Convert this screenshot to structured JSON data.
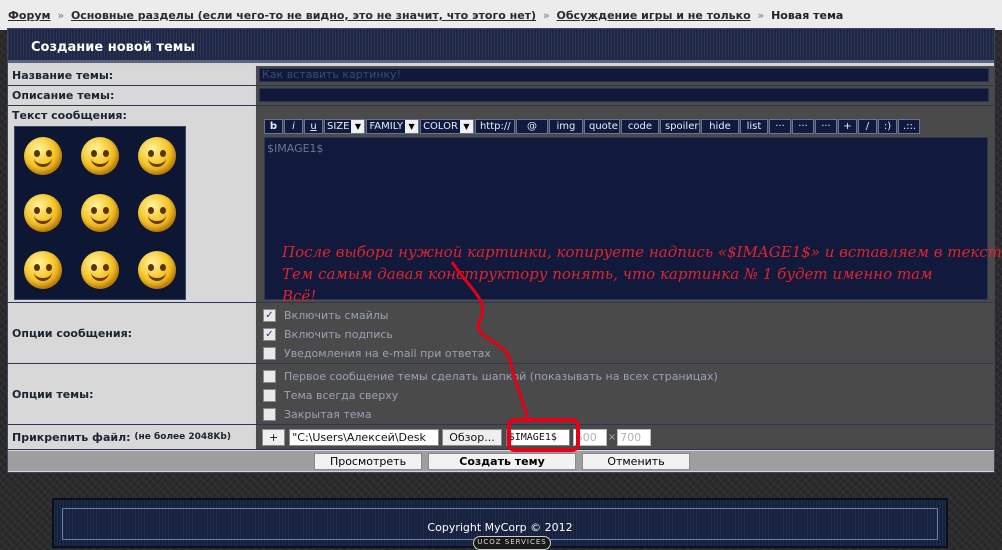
{
  "breadcrumbs": [
    {
      "label": "Форум"
    },
    {
      "label": "Основные разделы (если чего-то не видно, это не значит, что этого нет)"
    },
    {
      "label": "Обсуждение игры и не только"
    },
    {
      "label": "Новая тема"
    }
  ],
  "breadcrumb_sep": "»",
  "panel_title": "Создание новой темы",
  "fields": {
    "title_label": "Название темы:",
    "title_value": "Как вставить картинку!",
    "description_label": "Описание темы:",
    "description_value": "",
    "message_label": "Текст сообщения:",
    "message_value": "$IMAGE1$"
  },
  "toolbar": {
    "bold": "b",
    "italic": "i",
    "underline": "u",
    "size": "SIZE",
    "family": "FAMILY",
    "color": "COLOR",
    "url": "http://",
    "email": "@",
    "img": "img",
    "quote": "quote",
    "code": "code",
    "spoiler": "spoiler",
    "hide": "hide",
    "list": "list",
    "more1": "···",
    "more2": "···",
    "more3": "···",
    "plus": "+",
    "slash": "/",
    "smile": ":)",
    "dots": ".::."
  },
  "annotation": [
    "После выбора нужной картинки, копируете надпись «$IMAGE1$» и вставляем в текст…",
    "Тем самым давая конструктору понять, что картинка № 1 будет именно там",
    "Всё!"
  ],
  "message_options": {
    "label": "Опции сообщения:",
    "items": [
      {
        "label": "Включить смайлы",
        "checked": true
      },
      {
        "label": "Включить подпись",
        "checked": true
      },
      {
        "label": "Уведомления на e-mail при ответах",
        "checked": false
      }
    ]
  },
  "topic_options": {
    "label": "Опции темы:",
    "items": [
      {
        "label": "Первое сообщение темы сделать шапкой (показывать на всех страницах)",
        "checked": false
      },
      {
        "label": "Тема всегда сверху",
        "checked": false
      },
      {
        "label": "Закрытая тема",
        "checked": false
      }
    ]
  },
  "attach": {
    "label": "Прикрепить файл:",
    "limit": "(не более 2048Kb)",
    "add": "+",
    "path": "\"C:\\Users\\Алексей\\Desk",
    "browse": "Обзор...",
    "code": "$IMAGE1$",
    "width": "500",
    "height": "700",
    "times": "×"
  },
  "actions": {
    "preview": "Просмотреть",
    "create": "Создать тему",
    "cancel": "Отменить"
  },
  "footer": {
    "copyright": "Copyright MyCorp © 2012",
    "badge": "UCOZ SERVICES"
  }
}
